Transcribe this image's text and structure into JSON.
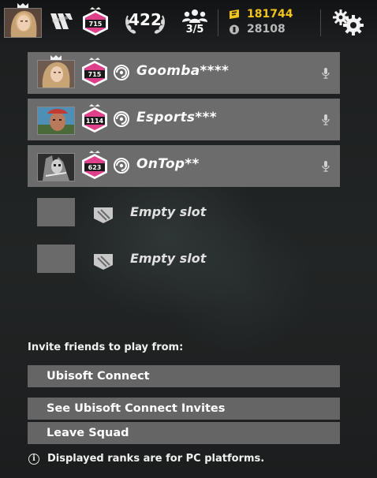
{
  "header": {
    "player_rank": "715",
    "level": "422",
    "squad_count": "3/5",
    "r6_credits": "181744",
    "renown": "28108",
    "colors": {
      "credits": "#f3c318",
      "renown": "#b9b9b9",
      "rank_badge": "#e0408a"
    },
    "icons": [
      "avatar",
      "crown-icon",
      "chevron-rank-icon",
      "rank-badge-icon",
      "laurel-icon",
      "squad-icon",
      "r6-credits-icon",
      "renown-icon",
      "settings-gear-icon"
    ]
  },
  "players": [
    {
      "name": "Goomba****",
      "rank": "715",
      "leader": true
    },
    {
      "name": "Esports***",
      "rank": "1114",
      "leader": false
    },
    {
      "name": "OnTop**",
      "rank": "623",
      "leader": false
    }
  ],
  "empty_slots": [
    {
      "label": "Empty slot"
    },
    {
      "label": "Empty slot"
    }
  ],
  "invite": {
    "label": "Invite friends to play from:",
    "buttons": {
      "ubisoft_connect": "Ubisoft Connect",
      "see_invites": "See Ubisoft Connect Invites",
      "leave_squad": "Leave Squad"
    }
  },
  "footer": {
    "info_text": "Displayed ranks are for PC platforms."
  }
}
